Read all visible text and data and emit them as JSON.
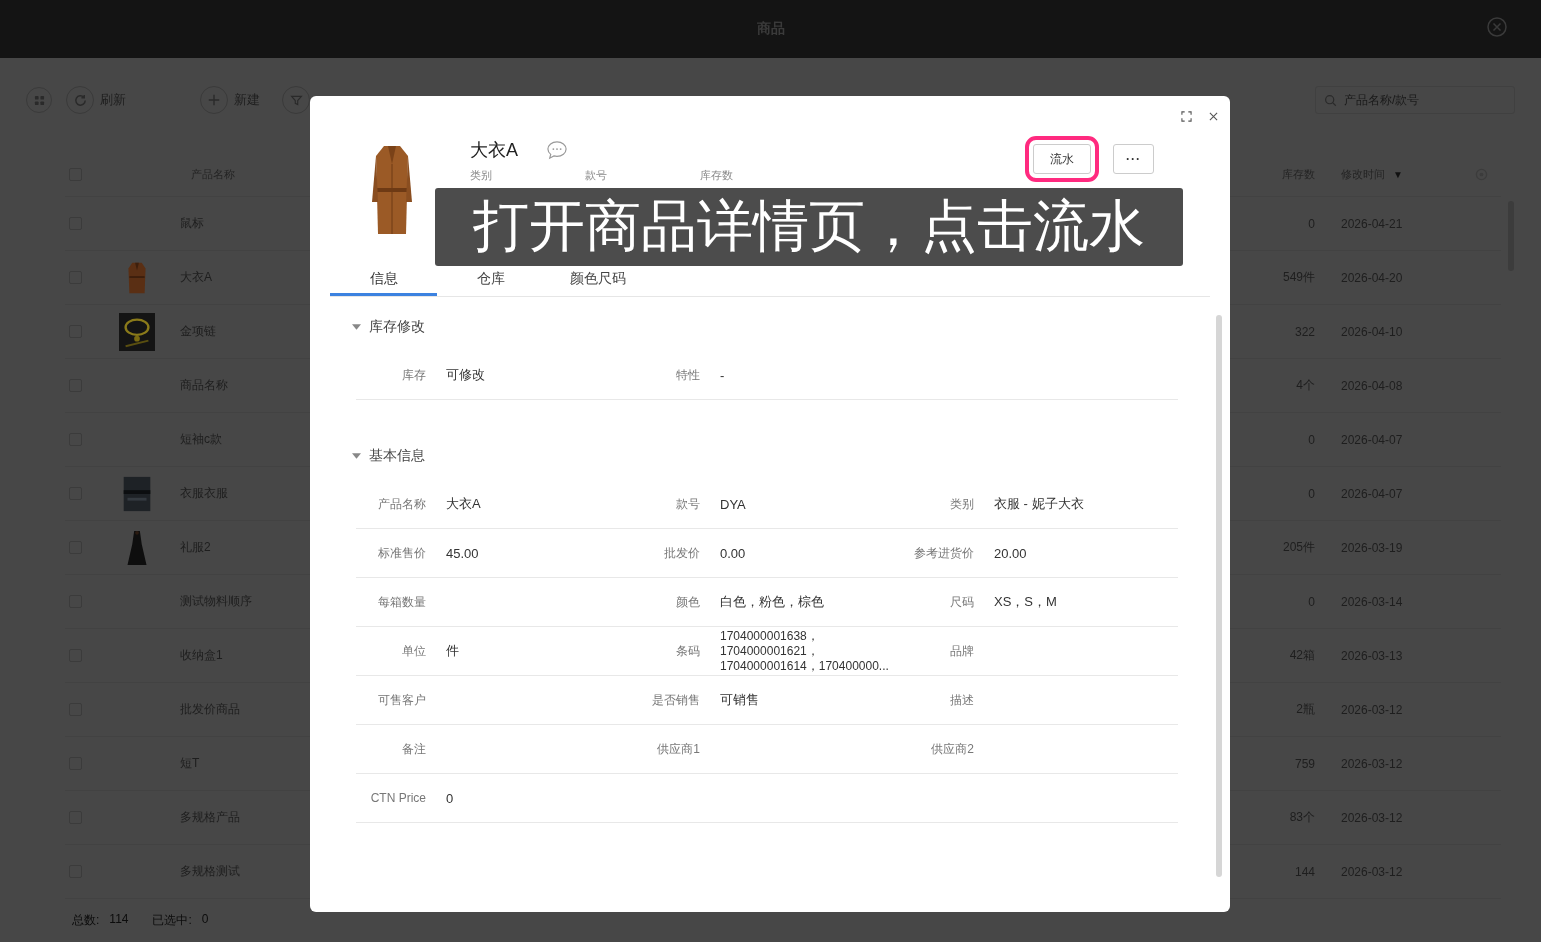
{
  "window": {
    "title": "商品"
  },
  "toolbar": [
    {
      "kind": "grid"
    },
    {
      "kind": "refresh",
      "label": "刷新"
    },
    {
      "kind": "add",
      "label": "新建"
    },
    {
      "kind": "filter"
    }
  ],
  "search": {
    "placeholder": "产品名称/款号"
  },
  "table": {
    "columns": [
      {
        "label": "产品名称"
      },
      {
        "label": "库存数"
      },
      {
        "label": "修改时间",
        "sort_mark": "▼"
      }
    ],
    "header_checked": false,
    "rows": [
      {
        "checked": false,
        "name": "鼠标",
        "stock": "0",
        "modified": "2026-04-21"
      },
      {
        "checked": false,
        "image": {
          "kind": "picture"
        },
        "name": "大衣A",
        "stock": "549件",
        "modified": "2026-04-20"
      },
      {
        "checked": false,
        "image": {
          "kind": "picture"
        },
        "name": "金项链",
        "stock": "322",
        "modified": "2026-04-10"
      },
      {
        "checked": false,
        "name": "商品名称",
        "stock": "4个",
        "modified": "2026-04-08"
      },
      {
        "checked": false,
        "name": "短袖c款",
        "stock": "0",
        "modified": "2026-04-07"
      },
      {
        "checked": false,
        "image": {
          "kind": "picture"
        },
        "name": "衣服衣服",
        "stock": "0",
        "modified": "2026-04-07"
      },
      {
        "checked": false,
        "image": {
          "kind": "picture"
        },
        "name": "礼服2",
        "stock": "205件",
        "modified": "2026-03-19"
      },
      {
        "checked": false,
        "name": "测试物料顺序",
        "stock": "0",
        "modified": "2026-03-14"
      },
      {
        "checked": false,
        "name": "收纳盒1",
        "stock": "42箱",
        "modified": "2026-03-13"
      },
      {
        "checked": false,
        "name": "批发价商品",
        "stock": "2瓶",
        "modified": "2026-03-12"
      },
      {
        "checked": false,
        "name": "短T",
        "stock": "759",
        "modified": "2026-03-12"
      },
      {
        "checked": false,
        "name": "多规格产品",
        "stock": "83个",
        "modified": "2026-03-12"
      },
      {
        "checked": false,
        "name": "多规格测试",
        "stock": "144",
        "modified": "2026-03-12"
      }
    ]
  },
  "footer": {
    "total_label": "总数:",
    "total": "114",
    "selected_label": "已选中:",
    "selected": "0"
  },
  "dialog": {
    "image": {
      "kind": "picture"
    },
    "name": "大衣A",
    "summary_labels": [
      "类别",
      "款号",
      "库存数"
    ],
    "buttons": [
      {
        "kind": "text",
        "label": "流水",
        "highlighted": true
      },
      {
        "kind": "more",
        "label": "···",
        "highlighted": false
      }
    ],
    "caption": "打开商品详情页，点击流水",
    "tabs": [
      {
        "label": "信息",
        "selected": true
      },
      {
        "label": "仓库",
        "selected": false
      },
      {
        "label": "颜色尺码",
        "selected": false
      }
    ],
    "sections": [
      {
        "title": "库存修改",
        "expanded": true,
        "fields": [
          {
            "label": "库存",
            "value": "可修改"
          },
          {
            "label": "特性",
            "value": "-"
          }
        ]
      },
      {
        "title": "基本信息",
        "expanded": true,
        "fields": [
          {
            "label": "产品名称",
            "value": "大衣A"
          },
          {
            "label": "款号",
            "value": "DYA"
          },
          {
            "label": "类别",
            "value": "衣服 - 妮子大衣"
          },
          {
            "label": "标准售价",
            "value": "45.00"
          },
          {
            "label": "批发价",
            "value": "0.00"
          },
          {
            "label": "参考进货价",
            "value": "20.00"
          },
          {
            "label": "每箱数量"
          },
          {
            "label": "颜色",
            "value": "白色，粉色，棕色"
          },
          {
            "label": "尺码",
            "value": "XS，S，M"
          },
          {
            "label": "单位",
            "value": "件"
          },
          {
            "label": "条码",
            "value": "1704000001638，\n1704000001621，\n1704000001614，170400000..."
          },
          {
            "label": "品牌"
          },
          {
            "label": "可售客户"
          },
          {
            "label": "是否销售",
            "value": "可销售"
          },
          {
            "label": "描述"
          },
          {
            "label": "备注"
          },
          {
            "label": "供应商1"
          },
          {
            "label": "供应商2"
          },
          {
            "label": "CTN Price",
            "value": "0"
          }
        ]
      }
    ]
  }
}
